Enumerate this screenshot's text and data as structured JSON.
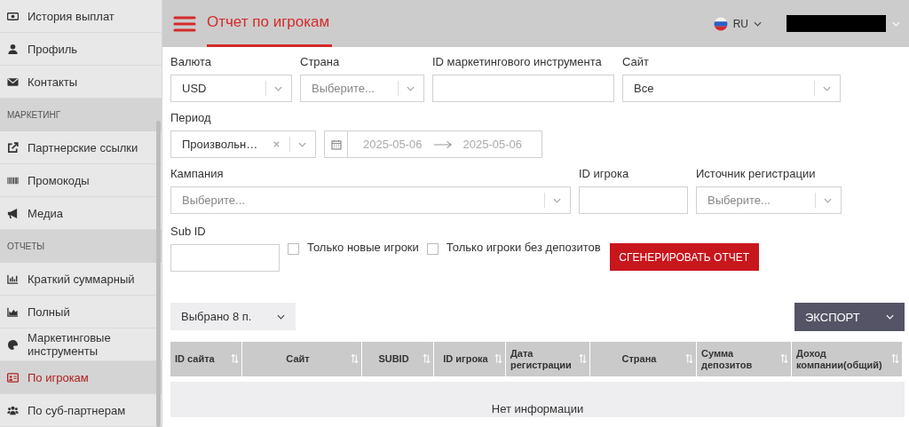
{
  "sidebar": {
    "items": [
      {
        "kind": "item",
        "label": "История выплат",
        "selected": false
      },
      {
        "kind": "item",
        "label": "Профиль",
        "selected": false
      },
      {
        "kind": "item",
        "label": "Контакты",
        "selected": false
      },
      {
        "kind": "section",
        "label": "МАРКЕТИНГ"
      },
      {
        "kind": "item",
        "label": "Партнерские ссылки",
        "selected": false
      },
      {
        "kind": "item",
        "label": "Промокоды",
        "selected": false
      },
      {
        "kind": "item",
        "label": "Медиа",
        "selected": false
      },
      {
        "kind": "section",
        "label": "ОТЧЕТЫ"
      },
      {
        "kind": "item",
        "label": "Краткий суммарный",
        "selected": false
      },
      {
        "kind": "item",
        "label": "Полный",
        "selected": false
      },
      {
        "kind": "item",
        "label": "Маркетинговые инструменты",
        "selected": false
      },
      {
        "kind": "item",
        "label": "По игрокам",
        "selected": true
      },
      {
        "kind": "item",
        "label": "По суб-партнерам",
        "selected": false
      }
    ]
  },
  "header": {
    "title": "Отчет по игрокам",
    "language": "RU"
  },
  "filters": {
    "currency": {
      "label": "Валюта",
      "value": "USD"
    },
    "country": {
      "label": "Страна",
      "placeholder": "Выберите..."
    },
    "marketing_tool_id": {
      "label": "ID маркетингового инструмента"
    },
    "site": {
      "label": "Сайт",
      "value": "Все"
    },
    "period": {
      "label": "Период",
      "value": "Произвольн…",
      "clearable": true
    },
    "date_range": {
      "start": "2025-05-06",
      "end": "2025-05-06"
    },
    "campaign": {
      "label": "Кампания",
      "placeholder": "Выберите..."
    },
    "player_id": {
      "label": "ID игрока"
    },
    "registration_source": {
      "label": "Источник регистрации",
      "placeholder": "Выберите..."
    },
    "sub_id": {
      "label": "Sub ID"
    },
    "checkboxes": [
      {
        "label": "Только новые игроки",
        "checked": false
      },
      {
        "label": "Только игроки без депозитов",
        "checked": false
      }
    ],
    "generate_button": "СГЕНЕРИРОВАТЬ ОТЧЕТ"
  },
  "columns_picker": "Выбрано 8 п.",
  "export_button": "ЭКСПОРТ",
  "table": {
    "columns": [
      "ID сайта",
      "Сайт",
      "SUBID",
      "ID игрока",
      "Дата регистрации",
      "Страна",
      "Сумма депозитов",
      "Доход компании(общий)"
    ],
    "empty_text": "Нет информации"
  }
}
